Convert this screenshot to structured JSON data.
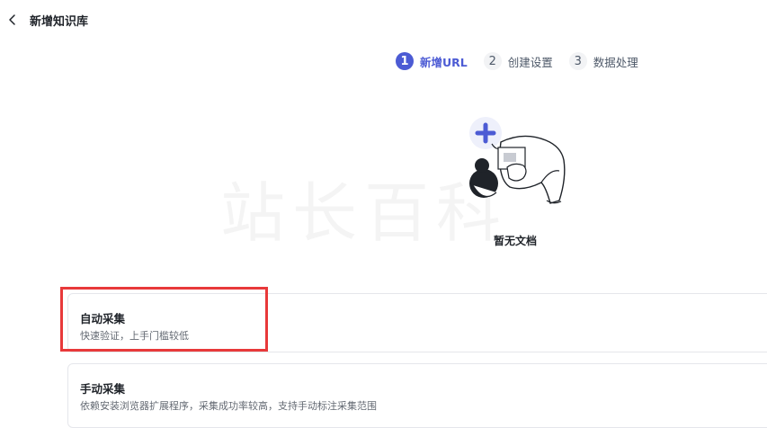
{
  "header": {
    "title": "新增知识库"
  },
  "steps": [
    {
      "number": "1",
      "label": "新增URL",
      "active": true
    },
    {
      "number": "2",
      "label": "创建设置",
      "active": false
    },
    {
      "number": "3",
      "label": "数据处理",
      "active": false
    }
  ],
  "empty_state": {
    "text": "暂无文档"
  },
  "watermark": "站长百科",
  "options": [
    {
      "title": "自动采集",
      "description": "快速验证，上手门槛较低"
    },
    {
      "title": "手动采集",
      "description": "依赖安装浏览器扩展程序，采集成功率较高，支持手动标注采集范围"
    }
  ],
  "colors": {
    "accent": "#4c5bd4",
    "highlight": "#e8393a"
  }
}
